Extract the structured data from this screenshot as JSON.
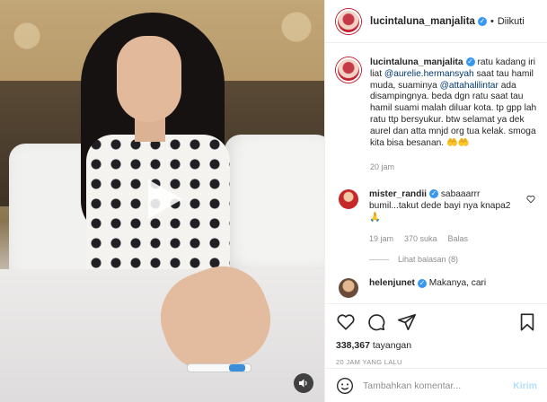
{
  "header": {
    "username": "lucintaluna_manjalita",
    "separator": "•",
    "follow_label": "Diikuti"
  },
  "caption": {
    "username": "lucintaluna_manjalita",
    "text_1": " ratu kadang iri liat ",
    "mention_1": "@aurelie.hermansyah",
    "text_2": " saat tau hamil muda, suaminya ",
    "mention_2": "@attahalilintar",
    "text_3": " ada disampingnya. beda dgn ratu saat tau hamil suami malah diluar kota. tp gpp lah ratu ttp bersyukur. btw selamat ya dek aurel dan atta mnjd org tua kelak. smoga kita bisa besanan. 🤲🤲",
    "time": "20 jam"
  },
  "comments": [
    {
      "username": "mister_randii",
      "text": " sabaaarrr bumil...takut dede bayi nya knapa2 🙏",
      "time": "19 jam",
      "likes": "370 suka",
      "reply": "Balas",
      "view_replies": "Lihat balasan (8)"
    },
    {
      "username": "helenjunet",
      "text": " Makanya, cari"
    }
  ],
  "stats": {
    "views_count": "338,367",
    "views_label": " tayangan",
    "date": "20 JAM YANG LALU"
  },
  "comment_box": {
    "placeholder": "Tambahkan komentar...",
    "post_label": "Kirim"
  },
  "icons": {
    "verified": "verified-badge-icon",
    "play": "play-icon",
    "audio": "speaker-icon",
    "like": "heart-icon",
    "comment": "comment-icon",
    "share": "send-icon",
    "save": "bookmark-icon",
    "emoji": "emoji-icon"
  },
  "colors": {
    "verified": "#3897f0",
    "link": "#00376b",
    "muted": "#8e8e8e",
    "post_disabled": "#b2dffc"
  }
}
